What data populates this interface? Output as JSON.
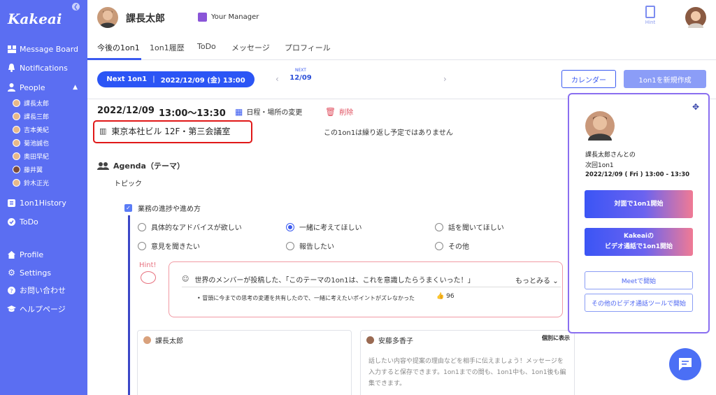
{
  "sidebar": {
    "logo": "Kakeai",
    "items": [
      {
        "label": "Message Board",
        "icon": "message-board-icon"
      },
      {
        "label": "Notifications",
        "icon": "bell-icon"
      },
      {
        "label": "People",
        "icon": "person-icon"
      }
    ],
    "people": [
      "課長太郎",
      "課長三郎",
      "吉本美紀",
      "菊池誠也",
      "奥田早紀",
      "藤井翼",
      "鈴木正光"
    ],
    "items2": [
      {
        "label": "1on1History",
        "icon": "history-icon"
      },
      {
        "label": "ToDo",
        "icon": "check-circle-icon"
      }
    ],
    "items3": [
      {
        "label": "Profile",
        "icon": "home-icon"
      },
      {
        "label": "Settings",
        "icon": "gear-icon"
      },
      {
        "label": "お問い合わせ",
        "icon": "help-icon"
      },
      {
        "label": "ヘルプページ",
        "icon": "graduation-cap-icon"
      }
    ]
  },
  "header": {
    "name": "課長太郎",
    "manager_label": "Your Manager",
    "hint_label": "Hint"
  },
  "tabs": [
    "今後の1on1",
    "1on1履歴",
    "ToDo",
    "メッセージ",
    "プロフィール"
  ],
  "main": {
    "next_label": "Next 1on1",
    "next_datetime": "2022/12/09 (金) 13:00",
    "pager_label": "NEXT",
    "pager_date": "12/09",
    "calendar_button": "カレンダー",
    "new_button": "1on1を新規作成",
    "date": "2022/12/09",
    "time": "13:00〜13:30",
    "change_action": "日程・場所の変更",
    "delete_action": "削除",
    "location": "東京本社ビル 12F・第三会議室",
    "repeat_note": "この1on1は繰り返し予定ではありません",
    "agenda_title": "Agenda（テーマ）",
    "topic_label": "トピック",
    "checkbox_label": "業務の進捗や進め方",
    "radios": [
      "具体的なアドバイスが欲しい",
      "一緒に考えてほしい",
      "話を聞いてほしい",
      "意見を聞きたい",
      "報告したい",
      "その他"
    ],
    "radio_selected": 1,
    "hint": {
      "label": "Hint!",
      "question": "世界のメンバーが投稿した、「このテーマの1on1は、これを意識したらうまくいった！」",
      "more": "もっとみる",
      "item": "冒頭に今までの思考の変遷を共有したので、一緒に考えたいポイントがズレなかった",
      "likes": "96"
    },
    "card_left_name": "課長太郎",
    "card_right_name": "安藤多香子",
    "individual_label": "個別に表示",
    "card_right_text": "話したい内容や提案の理由などを相手に伝えましょう！メッセージを入力すると保存できます。1on1までの間も、1on1中も、1on1後も編集できます。"
  },
  "panel": {
    "line1": "課長太郎さんとの",
    "line2": "次回1on1",
    "datetime": "2022/12/09 ( Fri ) 13:00 - 13:30",
    "btn_face": "対面で1on1開始",
    "btn_video_l1": "Kakeaiの",
    "btn_video_l2": "ビデオ通話で1on1開始",
    "btn_meet": "Meetで開始",
    "btn_other": "その他のビデオ通話ツールで開始"
  }
}
